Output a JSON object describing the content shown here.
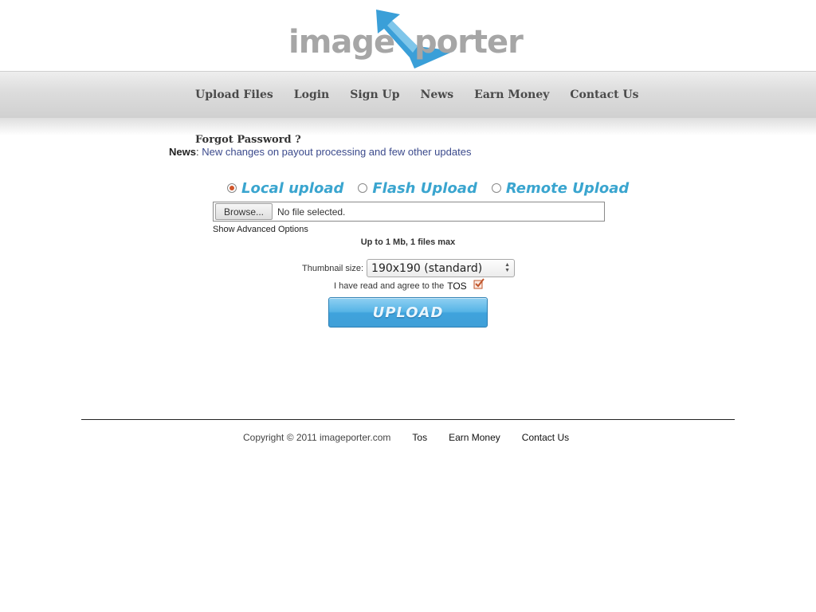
{
  "logo": {
    "left_text": "image",
    "right_text": "porter"
  },
  "nav": {
    "items": [
      {
        "label": "Upload Files"
      },
      {
        "label": "Login"
      },
      {
        "label": "Sign Up"
      },
      {
        "label": "News"
      },
      {
        "label": "Earn Money"
      },
      {
        "label": "Contact Us"
      }
    ]
  },
  "forgot_password": "Forgot Password ?",
  "news": {
    "label": "News",
    "separator": ":",
    "text": "New changes on payout processing and few other updates"
  },
  "upload_modes": [
    {
      "label": "Local upload",
      "selected": true
    },
    {
      "label": "Flash Upload",
      "selected": false
    },
    {
      "label": "Remote Upload",
      "selected": false
    }
  ],
  "file_input": {
    "button": "Browse...",
    "status": "No file selected."
  },
  "advanced_options": "Show Advanced Options",
  "limit_text": "Up to 1 Mb, 1 files max",
  "thumbnail": {
    "label": "Thumbnail size:",
    "value": "190x190 (standard)"
  },
  "tos": {
    "text": "I have read and agree to the",
    "link": "TOS",
    "checked": true
  },
  "upload_button": "UPLOAD",
  "footer": {
    "copyright": "Copyright © 2011 imageporter.com",
    "links": [
      {
        "label": "Tos"
      },
      {
        "label": "Earn Money"
      },
      {
        "label": "Contact Us"
      }
    ]
  },
  "colors": {
    "accent": "#3aa5cf",
    "radio_selected": "#d0552a",
    "nav_text": "#4a4a4a"
  }
}
